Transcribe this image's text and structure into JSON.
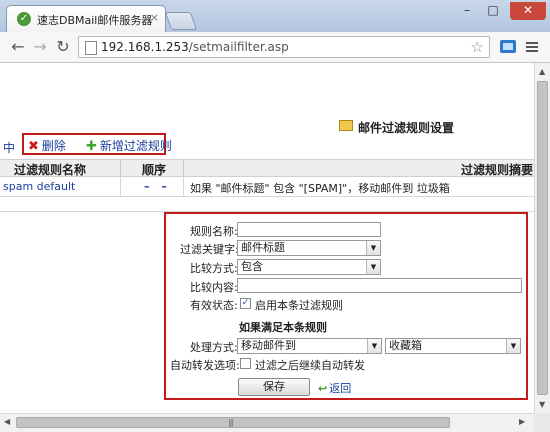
{
  "browser": {
    "tab_title": "速志DBMail邮件服务器 - V",
    "tab_close": "×",
    "url_host": "192.168.1.253",
    "url_path": "/setmailfilter.asp",
    "minimize": "–",
    "maximize": "□",
    "close": "✕"
  },
  "header": {
    "title": "邮件过滤规则设置",
    "fragment": "中"
  },
  "actions": {
    "delete_label": "删除",
    "add_label": "新增过滤规则"
  },
  "table": {
    "columns": [
      "过滤规则名称",
      "顺序",
      "过滤规则摘要"
    ],
    "rows": [
      {
        "name": "spam default",
        "order": "– –",
        "summary": "如果 \"邮件标题\" 包含 \"[SPAM]\"，移动邮件到 垃圾箱"
      }
    ]
  },
  "form": {
    "rule_name_label": "规则名称:",
    "rule_name_value": "",
    "keyword_label": "过滤关键字:",
    "keyword_value": "邮件标题",
    "compare_label": "比较方式:",
    "compare_value": "包含",
    "content_label": "比较内容:",
    "content_value": "",
    "status_label": "有效状态:",
    "status_checkbox_label": "启用本条过滤规则",
    "status_checked": true,
    "satisfy_title": "如果满足本条规则",
    "action_label": "处理方式:",
    "action_value": "移动邮件到",
    "target_value": "收藏箱",
    "forward_label": "自动转发选项:",
    "forward_checkbox_label": "过滤之后继续自动转发",
    "forward_checked": false,
    "save_label": "保存",
    "back_label": "返回"
  }
}
